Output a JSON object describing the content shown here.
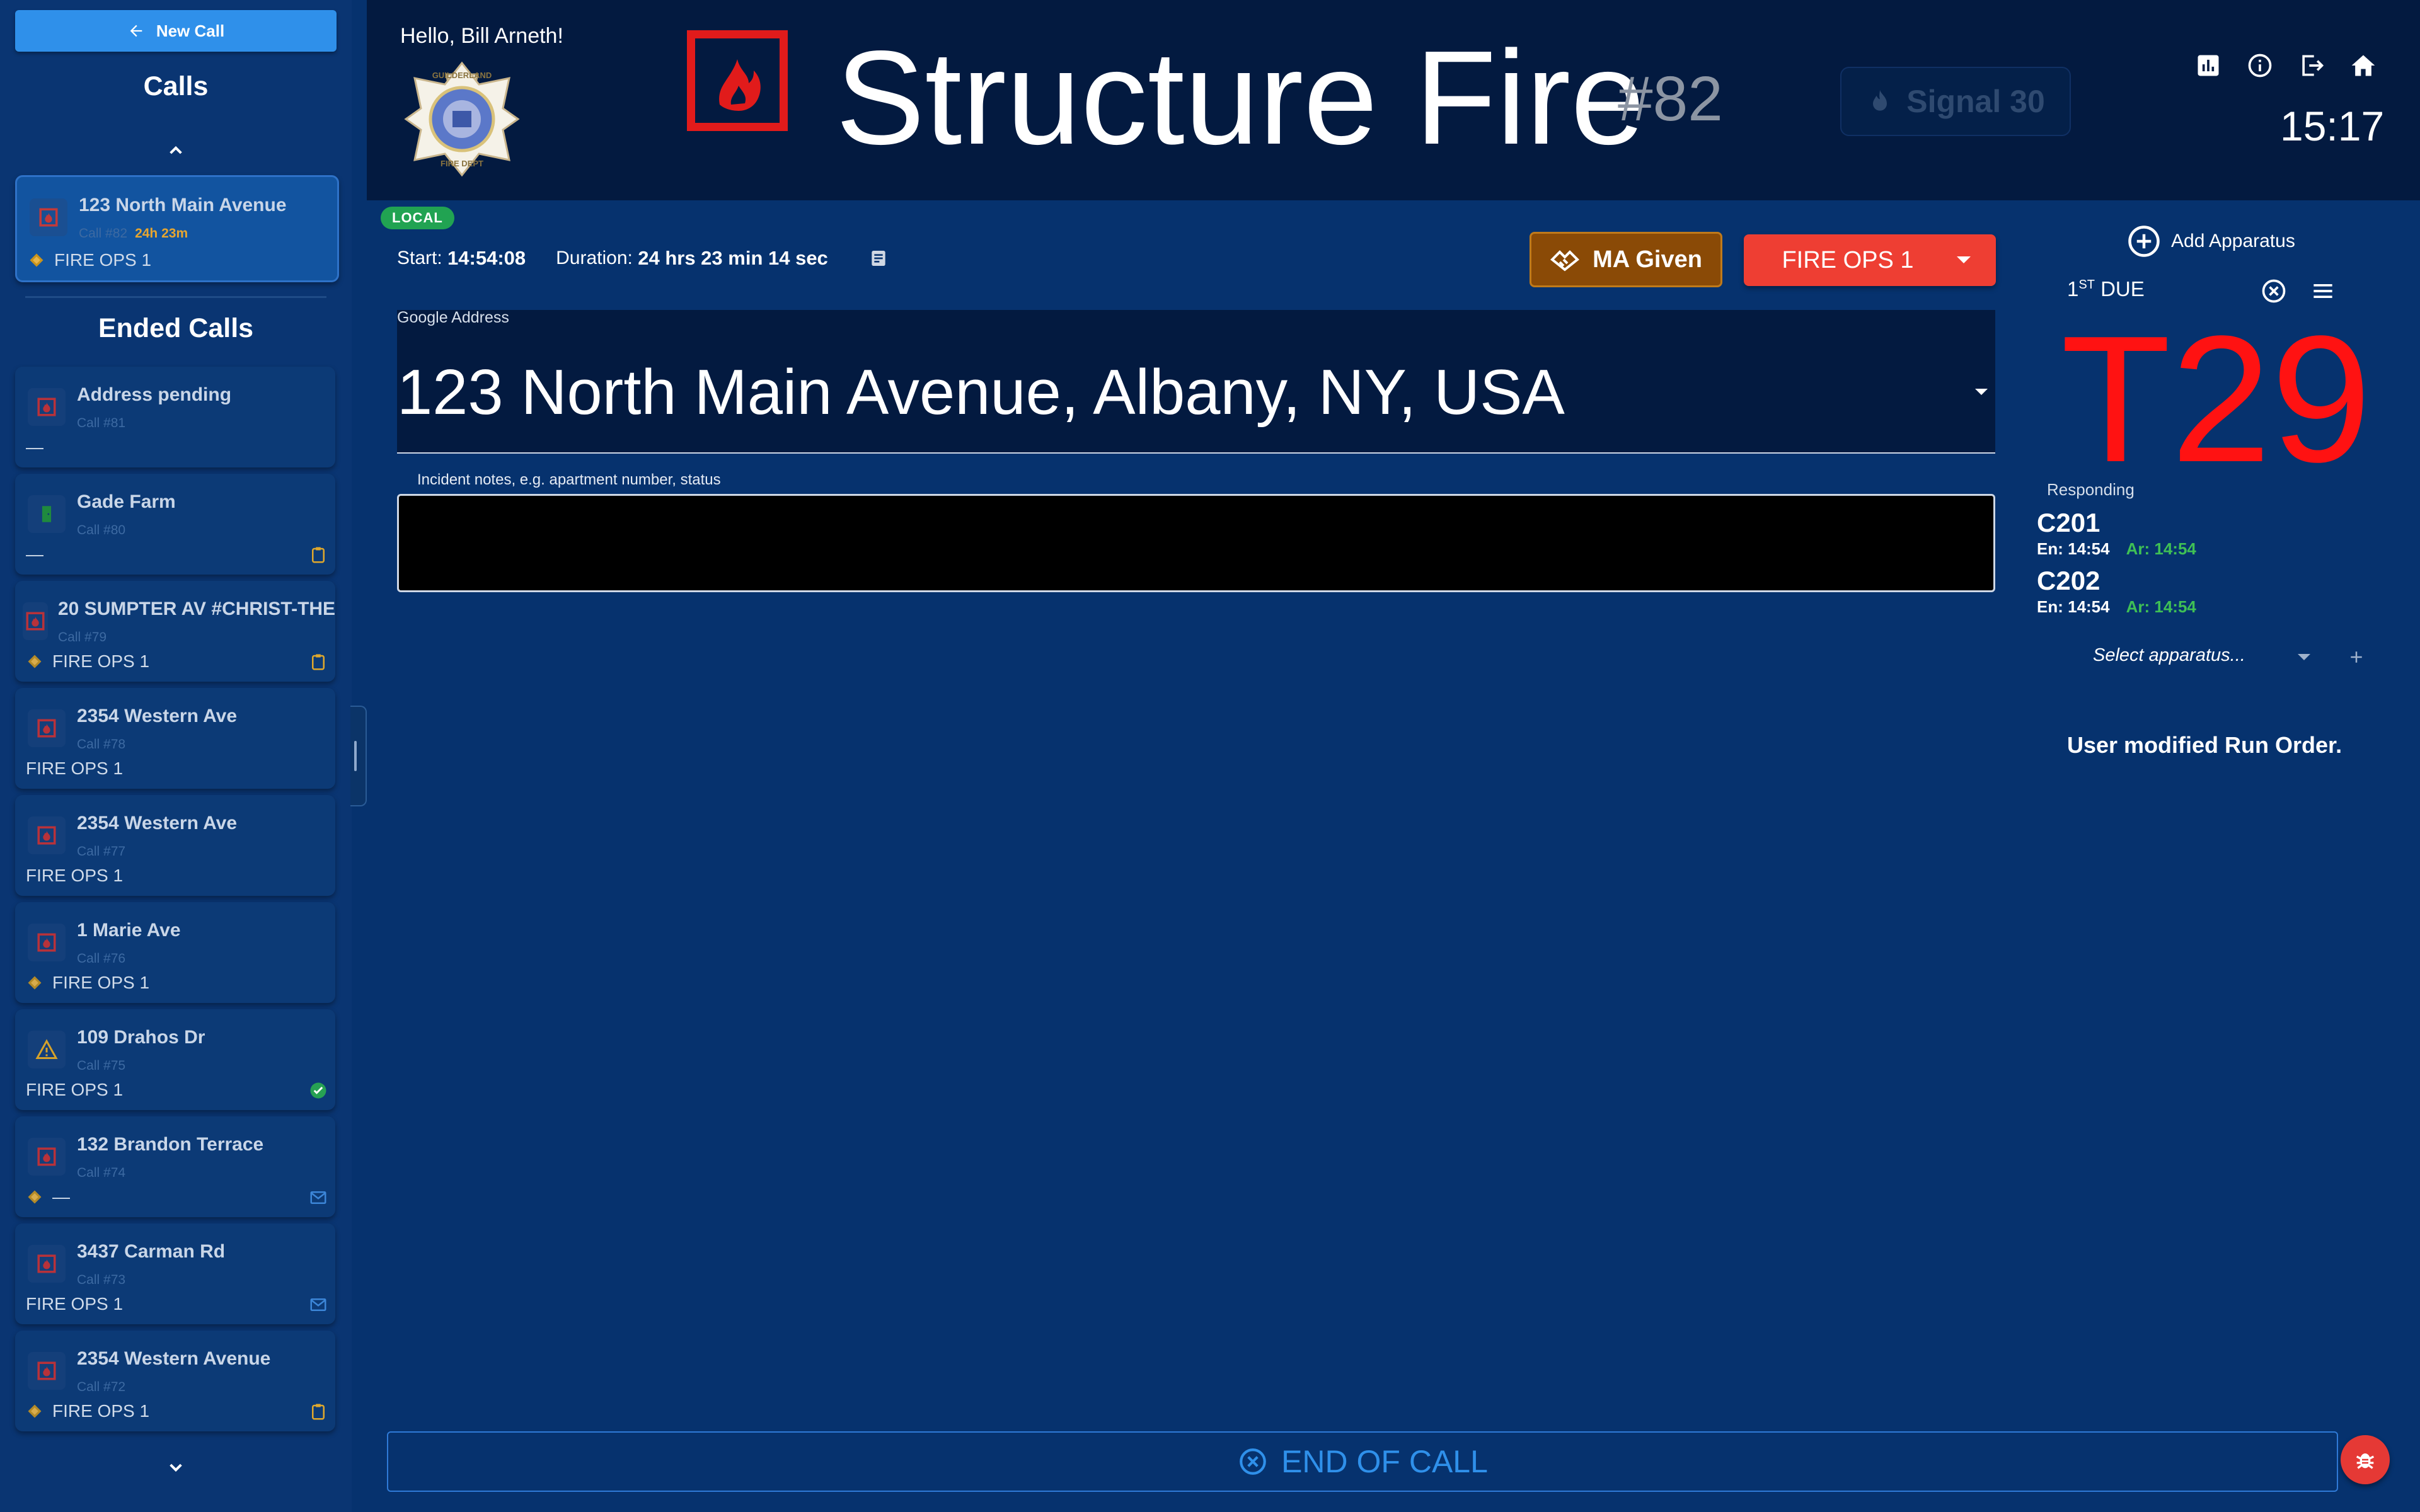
{
  "sidebar": {
    "new_call_label": "New Call",
    "calls_heading": "Calls",
    "ended_heading": "Ended Calls",
    "active_call": {
      "address": "123 North Main Avenue",
      "call_no": "Call #82",
      "duration": "24h 23m",
      "dispatch": "FIRE OPS 1",
      "icon": "fire-icon"
    },
    "ended_calls": [
      {
        "address": "Address pending",
        "call_no": "Call #81",
        "dispatch": "—",
        "icon": "fire-icon",
        "status_icon": ""
      },
      {
        "address": "Gade Farm",
        "call_no": "Call #80",
        "dispatch": "—",
        "icon": "green-door-icon",
        "status_icon": "clipboard-icon"
      },
      {
        "address": "20 SUMPTER AV #CHRIST-THE",
        "call_no": "Call #79",
        "dispatch": "FIRE OPS 1",
        "icon": "fire-icon",
        "status_icon": "clipboard-icon",
        "ma_icon": "handshake-icon"
      },
      {
        "address": "2354 Western Ave",
        "call_no": "Call #78",
        "dispatch": "FIRE OPS 1",
        "icon": "fire-icon",
        "status_icon": ""
      },
      {
        "address": "2354 Western Ave",
        "call_no": "Call #77",
        "dispatch": "FIRE OPS 1",
        "icon": "fire-icon",
        "status_icon": ""
      },
      {
        "address": "1 Marie Ave",
        "call_no": "Call #76",
        "dispatch": "FIRE OPS 1",
        "icon": "fire-icon",
        "status_icon": "",
        "ma_icon": "handshake-icon"
      },
      {
        "address": "109 Drahos Dr",
        "call_no": "Call #75",
        "dispatch": "FIRE OPS 1",
        "icon": "warning-icon",
        "status_icon": "check-circle-icon"
      },
      {
        "address": "132 Brandon Terrace",
        "call_no": "Call #74",
        "dispatch": "—",
        "icon": "fire-icon",
        "status_icon": "mail-icon",
        "ma_icon": "handshake-icon"
      },
      {
        "address": "3437 Carman Rd",
        "call_no": "Call #73",
        "dispatch": "FIRE OPS 1",
        "icon": "fire-icon",
        "status_icon": "mail-icon"
      },
      {
        "address": "2354 Western Avenue",
        "call_no": "Call #72",
        "dispatch": "FIRE OPS 1",
        "icon": "fire-icon",
        "status_icon": "clipboard-icon",
        "ma_icon": "handshake-icon"
      }
    ]
  },
  "header": {
    "greeting": "Hello, Bill Arneth!",
    "logo": {
      "top_text": "GUILDERLAND",
      "bottom_text": "FIRE DEPT"
    },
    "call_title": "Structure Fire",
    "call_number": "#82",
    "signal_label": "Signal 30",
    "clock": "15:17",
    "icons": [
      "chart-icon",
      "info-icon",
      "logout-icon",
      "home-icon"
    ]
  },
  "call": {
    "badge": "LOCAL",
    "start_label": "Start:",
    "start_value": "14:54:08",
    "duration_label": "Duration:",
    "duration_value": "24 hrs 23 min 14 sec",
    "ma_given_label": "MA Given",
    "dispatch_label": "FIRE OPS 1",
    "address_label": "Google Address",
    "address_value": "123 North Main Avenue, Albany, NY, USA",
    "notes_placeholder": "Incident notes, e.g. apartment number, status"
  },
  "apparatus": {
    "add_label": "Add Apparatus",
    "due_ordinal": "1",
    "due_suffix": "ST",
    "due_label": "DUE",
    "first_due_unit": "T29",
    "responding_label": "Responding",
    "units": [
      {
        "name": "C201",
        "en": "En: 14:54",
        "ar": "Ar: 14:54"
      },
      {
        "name": "C202",
        "en": "En: 14:54",
        "ar": "Ar: 14:54"
      }
    ],
    "select_placeholder": "Select apparatus...",
    "run_order_note": "User modified Run Order."
  },
  "footer": {
    "end_call_label": "END OF CALL"
  },
  "colors": {
    "background": "#06326e",
    "header": "#031a40",
    "accent": "#2f90ea",
    "danger": "#ee3e33",
    "first_due": "#ff1212",
    "ma_given": "#8a4a06",
    "ok_green": "#3fc055"
  }
}
